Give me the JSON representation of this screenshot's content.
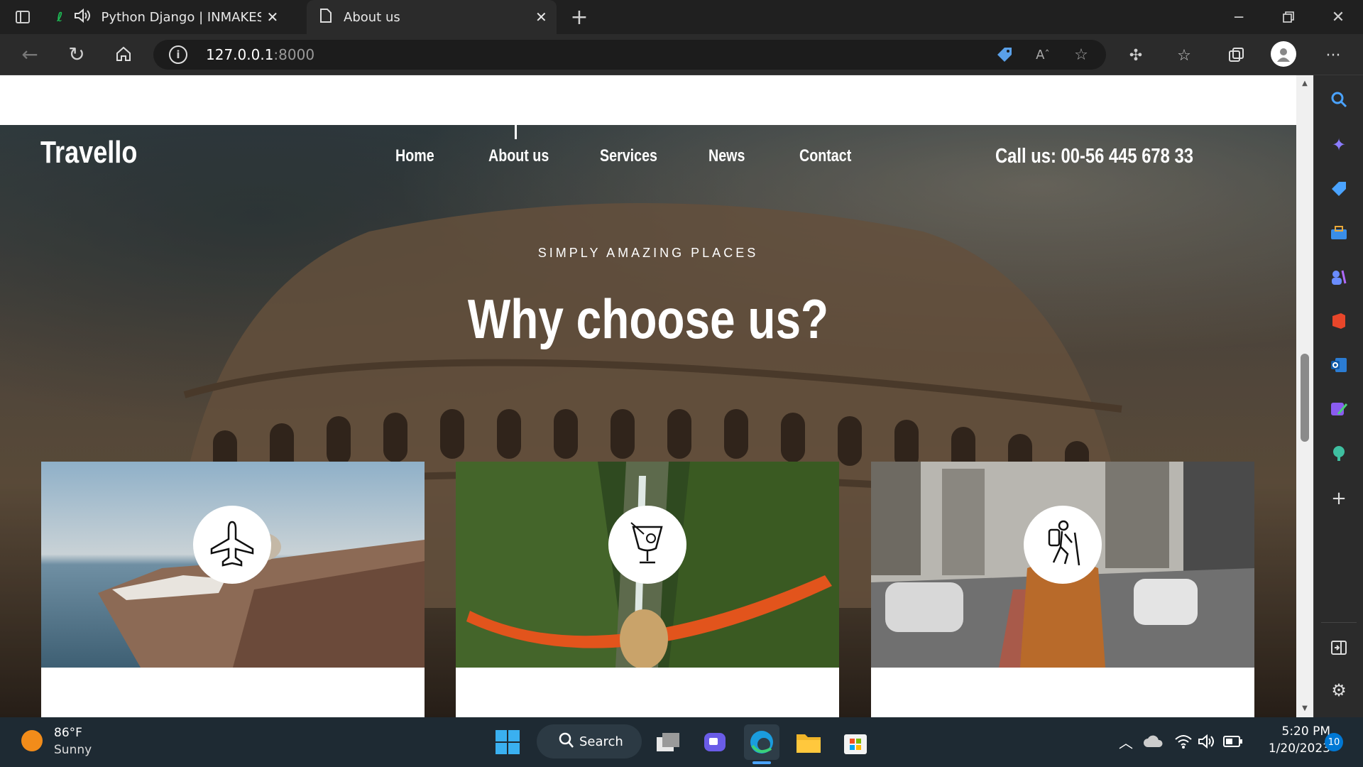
{
  "tabs": [
    {
      "title": "Python Django | INMAKES L",
      "icon": "django-icon"
    },
    {
      "title": "About us",
      "icon": "page-icon"
    }
  ],
  "address": {
    "host": "127.0.0.1",
    "port": ":8000"
  },
  "site": {
    "logo": "Travello",
    "nav": [
      "Home",
      "About us",
      "Services",
      "News",
      "Contact"
    ],
    "phone": "Call us: 00-56 445 678 33",
    "kicker": "SIMPLY AMAZING PLACES",
    "headline": "Why choose us?"
  },
  "cards": [
    {
      "icon": "airplane-icon",
      "scene": "venice"
    },
    {
      "icon": "cocktail-icon",
      "scene": "waterfall-hammock"
    },
    {
      "icon": "hiker-icon",
      "scene": "city-traveler"
    }
  ],
  "taskbar": {
    "weather_temp": "86°F",
    "weather_desc": "Sunny",
    "search_label": "Search",
    "time": "5:20 PM",
    "date": "1/20/2023",
    "notifications": "10"
  },
  "colors": {
    "accent": "#0078d4",
    "brand_text": "#ffffff"
  }
}
